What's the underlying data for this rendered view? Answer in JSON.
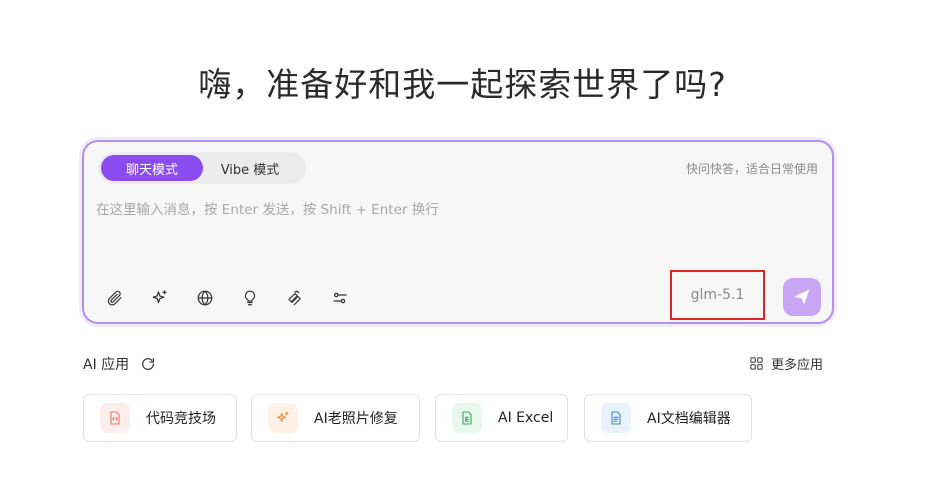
{
  "headline": "嗨，准备好和我一起探索世界了吗?",
  "chat": {
    "modes": [
      {
        "label": "聊天模式",
        "active": true
      },
      {
        "label": "Vibe 模式",
        "active": false
      }
    ],
    "hint": "快问快答，适合日常使用",
    "placeholder": "在这里输入消息，按 Enter 发送，按 Shift + Enter 换行",
    "tools": [
      "paperclip-icon",
      "sparkle-icon",
      "globe-icon",
      "lightbulb-icon",
      "layers-icon",
      "sliders-icon"
    ],
    "model": "glm-5.1"
  },
  "apps": {
    "title": "AI 应用",
    "more_label": "更多应用",
    "items": [
      {
        "label": "代码竞技场",
        "icon": "code-file-icon",
        "color": "#f26b5b",
        "bg": "#fdeeee"
      },
      {
        "label": "AI老照片修复",
        "icon": "sparkle-icon",
        "color": "#f5883a",
        "bg": "#fef1e6"
      },
      {
        "label": "AI Excel",
        "icon": "excel-icon",
        "color": "#2fae5b",
        "bg": "#e9f7ee"
      },
      {
        "label": "AI文档编辑器",
        "icon": "doc-icon",
        "color": "#3a86e0",
        "bg": "#e8f1fc"
      }
    ]
  },
  "colors": {
    "accent": "#8a4cf0",
    "send": "#c9a6f5",
    "highlight_box": "#e02424"
  }
}
